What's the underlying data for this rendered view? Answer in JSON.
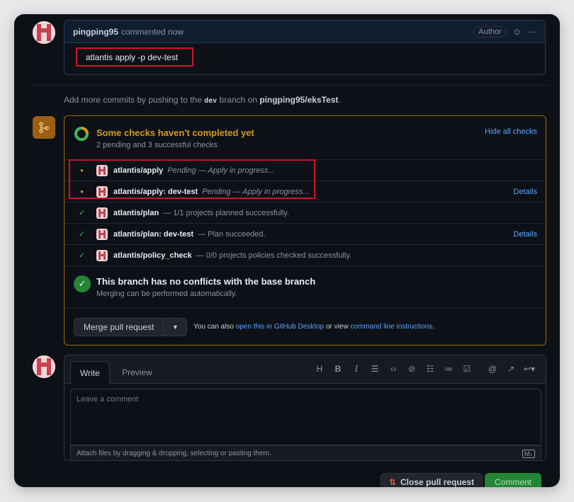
{
  "comment": {
    "username": "pingping95",
    "action": "commented now",
    "badge": "Author",
    "body": "atlantis apply -p dev-test"
  },
  "hint": {
    "prefix": "Add more commits by pushing to the",
    "branch": "dev",
    "middle": "branch on",
    "repo": "pingping95/eksTest",
    "suffix": "."
  },
  "checks": {
    "title": "Some checks haven't completed yet",
    "subtitle": "2 pending and 3 successful checks",
    "hide_label": "Hide all checks",
    "rows": [
      {
        "name": "atlantis/apply",
        "desc": "Pending — Apply in progress...",
        "status": "pending",
        "details": ""
      },
      {
        "name": "atlantis/apply: dev-test",
        "desc": "Pending — Apply in progress...",
        "status": "pending",
        "details": "Details"
      },
      {
        "name": "atlantis/plan",
        "desc": "— 1/1 projects planned successfully.",
        "status": "success",
        "details": ""
      },
      {
        "name": "atlantis/plan: dev-test",
        "desc": "— Plan succeeded.",
        "status": "success",
        "details": "Details"
      },
      {
        "name": "atlantis/policy_check",
        "desc": "— 0/0 projects policies checked successfully.",
        "status": "success",
        "details": ""
      }
    ]
  },
  "conflict": {
    "title": "This branch has no conflicts with the base branch",
    "subtitle": "Merging can be performed automatically."
  },
  "merge": {
    "button_label": "Merge pull request",
    "note_prefix": "You can also",
    "link_desktop": "open this in GitHub Desktop",
    "note_middle": "or view",
    "link_cli": "command line instructions",
    "note_suffix": "."
  },
  "editor": {
    "tab_write": "Write",
    "tab_preview": "Preview",
    "placeholder": "Leave a comment",
    "attach_text": "Attach files by dragging & dropping, selecting or pasting them.",
    "tools": [
      "H",
      "B",
      "I"
    ]
  },
  "actions": {
    "close_label": "Close pull request",
    "comment_label": "Comment"
  },
  "colors": {
    "accent_pending": "#d29922",
    "accent_success": "#3fb950",
    "link": "#58a6ff",
    "highlight": "#d0142c"
  }
}
